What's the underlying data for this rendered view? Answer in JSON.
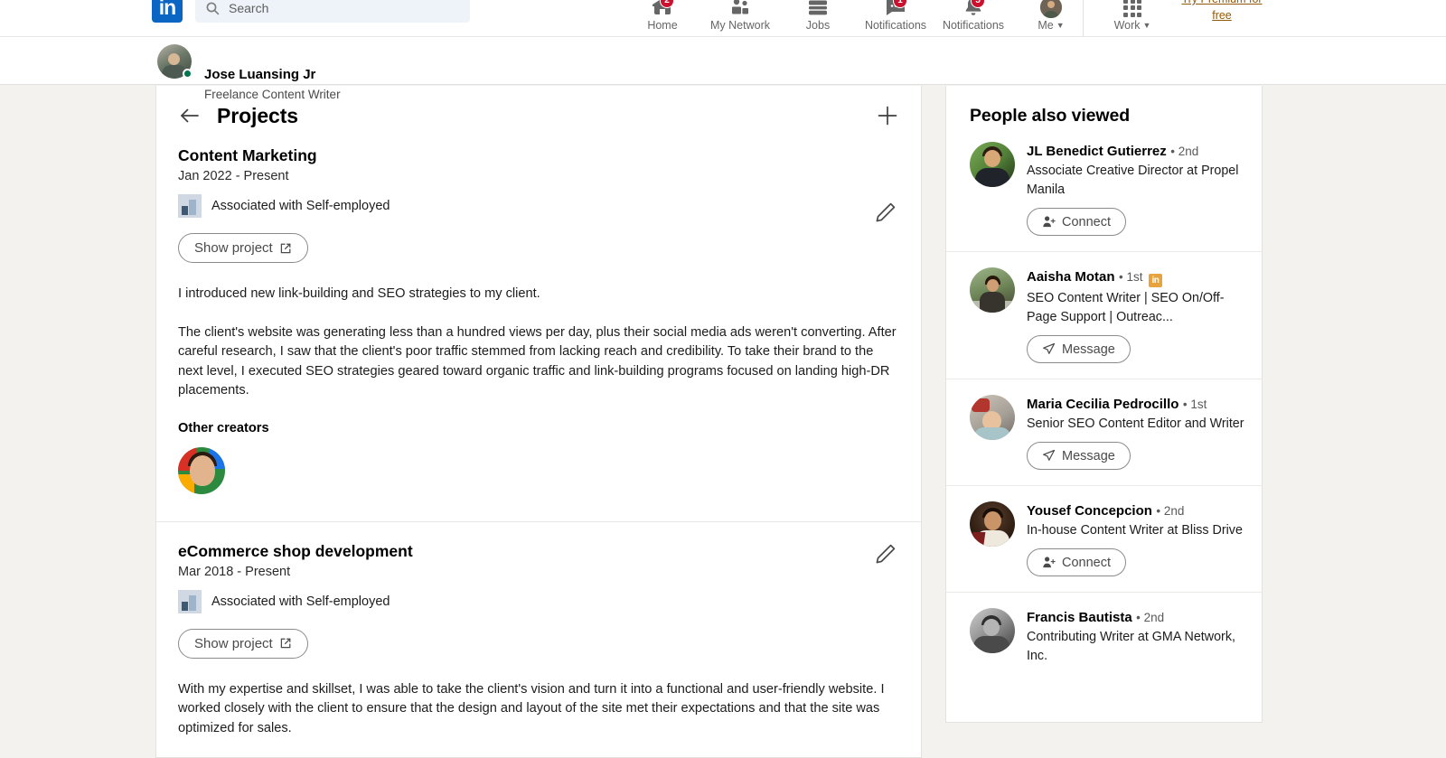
{
  "nav": {
    "logo": "in",
    "search_placeholder": "Search",
    "items": [
      {
        "label": "Home",
        "icon": "home-icon",
        "badge": "2"
      },
      {
        "label": "My Network",
        "icon": "people-icon",
        "badge": ""
      },
      {
        "label": "Jobs",
        "icon": "briefcase-icon",
        "badge": ""
      },
      {
        "label": "Messaging",
        "icon": "message-icon",
        "badge": "1"
      },
      {
        "label": "Notifications",
        "icon": "bell-icon",
        "badge": "5"
      },
      {
        "label": "Me",
        "icon": "avatar-icon",
        "badge": ""
      }
    ],
    "work_label": "Work",
    "work_icon": "grid-icon",
    "premium_text": "Try Premium for free"
  },
  "profile_bar": {
    "name": "Jose Luansing Jr",
    "headline": "Freelance Content Writer",
    "status": "online"
  },
  "main": {
    "back_icon": "back-arrow-icon",
    "title": "Projects",
    "add_icon": "plus-icon",
    "edit_icon": "pencil-icon",
    "projects": [
      {
        "title": "Content Marketing",
        "dates": "Jan 2022 - Present",
        "association": "Associated with Self-employed",
        "show_label": "Show project",
        "paragraphs": [
          "I introduced new link-building and SEO strategies to my client.",
          "The client's website was generating less than a hundred views per day, plus their social media ads weren't converting. After careful research, I saw that the client's poor traffic stemmed from lacking reach and credibility. To take their brand to the next level, I executed SEO strategies geared toward organic traffic and link-building programs focused on landing high-DR placements."
        ],
        "creators_label": "Other creators"
      },
      {
        "title": "eCommerce shop development",
        "dates": "Mar 2018 - Present",
        "association": "Associated with Self-employed",
        "show_label": "Show project",
        "paragraphs": [
          "With my expertise and skillset, I was able to take the client's vision and turn it into a functional and user-friendly website. I worked closely with the client to ensure that the design and layout of the site met their expectations and that the site was optimized for sales."
        ]
      }
    ]
  },
  "sidebar": {
    "title": "People also viewed",
    "people": [
      {
        "name": "JL Benedict Gutierrez",
        "degree": "• 2nd",
        "premium": false,
        "headline": "Associate Creative Director at Propel Manila",
        "action": "Connect",
        "action_icon": "person-add-icon"
      },
      {
        "name": "Aaisha Motan",
        "degree": "• 1st",
        "premium": true,
        "headline": "SEO Content Writer | SEO On/Off-Page Support | Outreac...",
        "action": "Message",
        "action_icon": "send-icon"
      },
      {
        "name": "Maria Cecilia Pedrocillo",
        "degree": "• 1st",
        "premium": false,
        "headline": "Senior SEO Content Editor and Writer",
        "action": "Message",
        "action_icon": "send-icon"
      },
      {
        "name": "Yousef Concepcion",
        "degree": "• 2nd",
        "premium": false,
        "headline": "In-house Content Writer at Bliss Drive",
        "action": "Connect",
        "action_icon": "person-add-icon"
      },
      {
        "name": "Francis Bautista",
        "degree": "• 2nd",
        "premium": false,
        "headline": "Contributing Writer at GMA Network, Inc.",
        "action": "",
        "action_icon": ""
      }
    ]
  },
  "colors": {
    "brand": "#0a66c2",
    "page_bg": "#f3f2ef",
    "premium_gold": "#e7a33e",
    "badge_red": "#cb112d",
    "online_green": "#01754f"
  }
}
